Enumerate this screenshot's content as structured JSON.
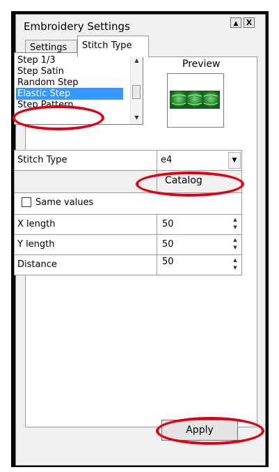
{
  "window": {
    "title": "Embroidery Settings",
    "help_glyph": "▲",
    "close_glyph": "X"
  },
  "tabs": [
    {
      "label": "Settings",
      "active": false
    },
    {
      "label": "Stitch Type",
      "active": true
    }
  ],
  "stitch_list": {
    "items": [
      "Step 1/3",
      "Step Satin",
      "Random Step",
      "Elastic Step",
      "Step Pattern"
    ],
    "selected": "Elastic Step"
  },
  "preview": {
    "label": "Preview"
  },
  "properties": {
    "stitch_type": {
      "label": "Stitch Type",
      "value": "e4"
    },
    "catalog_label": "Catalog",
    "same_values": {
      "label": "Same values",
      "checked": false
    },
    "x_length": {
      "label": "X length",
      "value": "50"
    },
    "y_length": {
      "label": "Y length",
      "value": "50"
    },
    "distance": {
      "label": "Distance",
      "value": "50"
    }
  },
  "apply_label": "Apply",
  "highlight_color": "#e00010",
  "selection_color": "#3399ff"
}
